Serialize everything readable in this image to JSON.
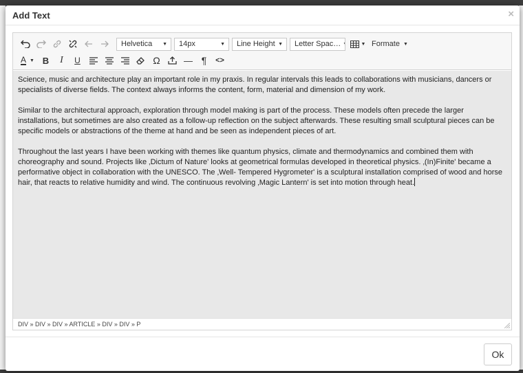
{
  "dialog": {
    "title": "Add Text",
    "close_symbol": "×",
    "ok_label": "Ok"
  },
  "toolbar": {
    "row1": {
      "font_family": "Helvetica",
      "font_size": "14px",
      "line_height": "Line Height",
      "letter_spacing": "Letter Spac…",
      "formats_label": "Formate"
    },
    "icons_row1": [
      "undo-icon",
      "redo-icon",
      "link-icon",
      "unlink-icon",
      "arrow-left-icon",
      "arrow-right-icon",
      "table-icon"
    ],
    "icons_row2": [
      "text-color-icon",
      "bold-icon",
      "italic-icon",
      "underline-icon",
      "align-left-icon",
      "align-center-icon",
      "align-right-icon",
      "eraser-icon",
      "omega-icon",
      "upload-icon",
      "horizontal-rule-icon",
      "pilcrow-icon",
      "code-icon"
    ],
    "text_color_letter": "A",
    "bold_letter": "B",
    "italic_letter": "I",
    "underline_letter": "U",
    "omega": "Ω",
    "pilcrow": "¶",
    "code": "<>",
    "hr": "—"
  },
  "content": {
    "paragraphs": [
      "Science, music and architecture play an important role in my praxis. In regular intervals this leads to collaborations with musicians, dancers or specialists of diverse fields. The context always informs the content, form, material and dimension of my work.",
      "Similar to the architectural approach, exploration through model making is part of the process. These models often precede the larger installations, but sometimes are also created as a follow-up reflection on the subject afterwards. These resulting small sculptural pieces can be specific models or abstractions of the theme at hand and be seen as independent pieces of art.",
      "Throughout the last years I have been working with themes like quantum physics, climate and thermodynamics and combined them with choreography and sound. Projects like ‚Dictum of Nature' looks at geometrical formulas developed in theoretical physics. ‚(In)Finite' became a performative object in collaboration with the UNESCO. The ‚Well- Tempered Hygrometer' is a sculptural installation comprised of wood and horse hair, that reacts to relative humidity and wind. The continuous revolving ‚Magic Lantern' is set into motion through heat."
    ]
  },
  "statusbar": {
    "path": "DIV » DIV » DIV » ARTICLE » DIV » DIV » P"
  },
  "colors": {
    "overlay": "#3c3c3c",
    "editor_bg": "#e8e8e8",
    "toolbar_bg": "#f7f7f7"
  }
}
